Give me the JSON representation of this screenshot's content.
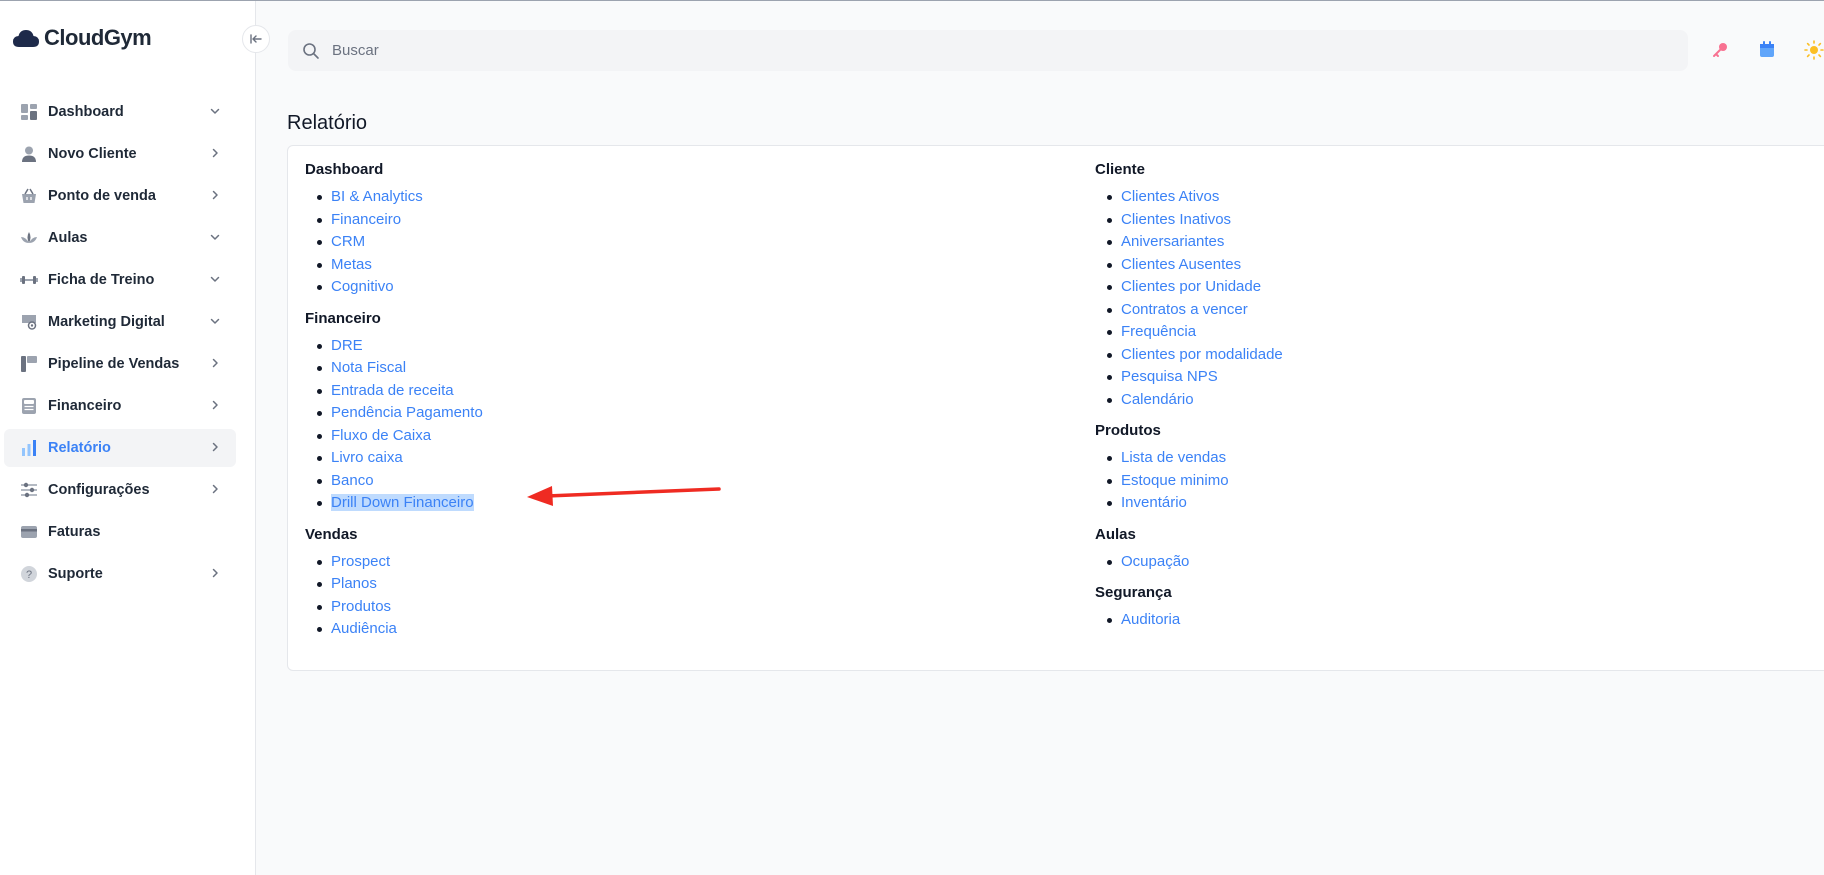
{
  "app": {
    "brand": "CloudGym",
    "brand_color": "#1e2a4a",
    "accent_color": "#3b82f6"
  },
  "sidebar": {
    "items": [
      {
        "label": "Dashboard",
        "icon": "dashboard-grid-icon",
        "chevron": "down"
      },
      {
        "label": "Novo Cliente",
        "icon": "user-icon",
        "chevron": "right"
      },
      {
        "label": "Ponto de venda",
        "icon": "basket-icon",
        "chevron": "right"
      },
      {
        "label": "Aulas",
        "icon": "lotus-icon",
        "chevron": "down"
      },
      {
        "label": "Ficha de Treino",
        "icon": "dumbbell-icon",
        "chevron": "down"
      },
      {
        "label": "Marketing Digital",
        "icon": "megaphone-icon",
        "chevron": "down"
      },
      {
        "label": "Pipeline de Vendas",
        "icon": "pipeline-icon",
        "chevron": "right"
      },
      {
        "label": "Financeiro",
        "icon": "calculator-icon",
        "chevron": "right"
      },
      {
        "label": "Relatório",
        "icon": "bar-chart-icon",
        "chevron": "right",
        "active": true
      },
      {
        "label": "Configurações",
        "icon": "sliders-icon",
        "chevron": "right"
      },
      {
        "label": "Faturas",
        "icon": "credit-card-icon",
        "chevron": ""
      },
      {
        "label": "Suporte",
        "icon": "help-icon",
        "chevron": "right"
      }
    ]
  },
  "search": {
    "placeholder": "Buscar"
  },
  "topbar": {
    "icons": [
      "key-icon",
      "calendar-icon",
      "sun-icon"
    ]
  },
  "page": {
    "title": "Relatório"
  },
  "sections": {
    "left": [
      {
        "title": "Dashboard",
        "links": [
          "BI & Analytics",
          "Financeiro",
          "CRM",
          "Metas",
          "Cognitivo"
        ]
      },
      {
        "title": "Financeiro",
        "links": [
          "DRE",
          "Nota Fiscal",
          "Entrada de receita",
          "Pendência Pagamento",
          "Fluxo de Caixa",
          "Livro caixa",
          "Banco",
          "Drill Down Financeiro"
        ]
      },
      {
        "title": "Vendas",
        "links": [
          "Prospect",
          "Planos",
          "Produtos",
          "Audiência"
        ]
      }
    ],
    "right": [
      {
        "title": "Cliente",
        "links": [
          "Clientes Ativos",
          "Clientes Inativos",
          "Aniversariantes",
          "Clientes Ausentes",
          "Clientes por Unidade",
          "Contratos a vencer",
          "Frequência",
          "Clientes por modalidade",
          "Pesquisa NPS",
          "Calendário"
        ]
      },
      {
        "title": "Produtos",
        "links": [
          "Lista de vendas",
          "Estoque minimo",
          "Inventário"
        ]
      },
      {
        "title": "Aulas",
        "links": [
          "Ocupação"
        ]
      },
      {
        "title": "Segurança",
        "links": [
          "Auditoria"
        ]
      }
    ]
  },
  "highlighted_link": "Drill Down Financeiro",
  "annotation": {
    "type": "arrow",
    "color": "#ef2b22"
  }
}
